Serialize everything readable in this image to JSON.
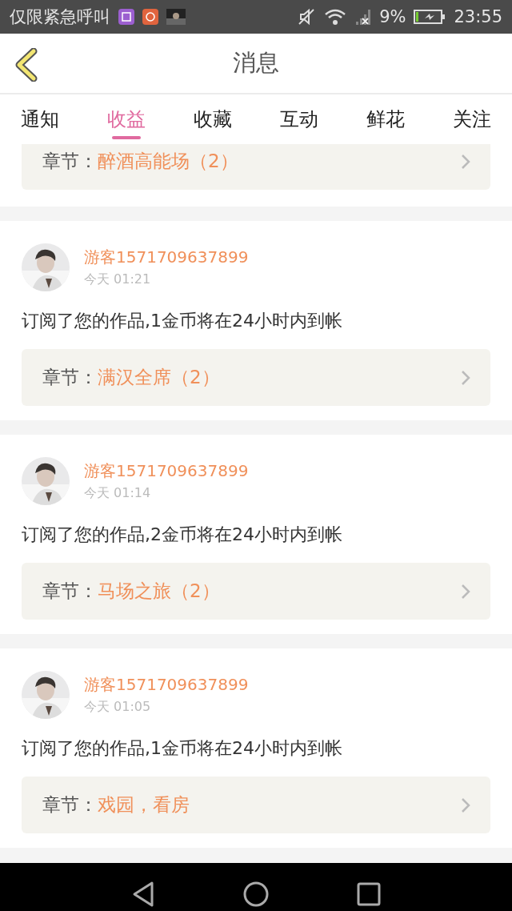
{
  "status_bar": {
    "carrier": "仅限紧急呼叫",
    "battery": "9%",
    "time": "23:55"
  },
  "header": {
    "title": "消息"
  },
  "tabs": [
    {
      "label": "通知",
      "selected": false
    },
    {
      "label": "收益",
      "selected": true
    },
    {
      "label": "收藏",
      "selected": false
    },
    {
      "label": "互动",
      "selected": false
    },
    {
      "label": "鲜花",
      "selected": false
    },
    {
      "label": "关注",
      "selected": false
    }
  ],
  "partial_item": {
    "chapter_label": "章节：",
    "chapter": "醉酒高能场（2）"
  },
  "messages": [
    {
      "user": "游客1571709637899",
      "time": "今天 01:21",
      "text": "订阅了您的作品,1金币将在24小时内到帐",
      "chapter_label": "章节：",
      "chapter": "满汉全席（2）"
    },
    {
      "user": "游客1571709637899",
      "time": "今天 01:14",
      "text": "订阅了您的作品,2金币将在24小时内到帐",
      "chapter_label": "章节：",
      "chapter": "马场之旅（2）"
    },
    {
      "user": "游客1571709637899",
      "time": "今天 01:05",
      "text": "订阅了您的作品,1金币将在24小时内到帐",
      "chapter_label": "章节：",
      "chapter": "戏园，看房"
    }
  ]
}
